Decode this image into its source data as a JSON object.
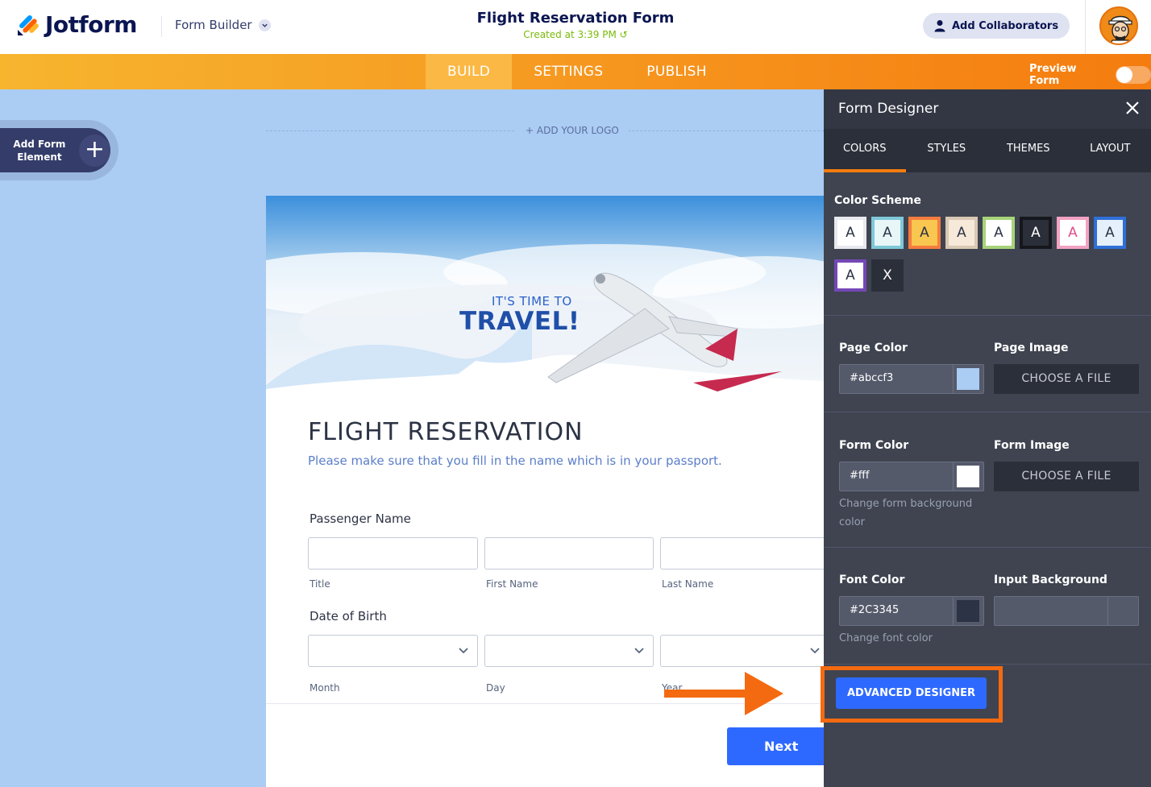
{
  "header": {
    "logo_text": "Jotform",
    "builder_label": "Form Builder",
    "form_title": "Flight Reservation Form",
    "created_text": "Created at 3:39 PM",
    "collab_label": "Add Collaborators"
  },
  "nav": {
    "tabs": [
      {
        "label": "BUILD",
        "active": true
      },
      {
        "label": "SETTINGS",
        "active": false
      },
      {
        "label": "PUBLISH",
        "active": false
      }
    ],
    "preview_label": "Preview Form",
    "preview_on": false
  },
  "canvas": {
    "add_element_label": "Add Form Element",
    "add_logo_label": "+ ADD YOUR LOGO",
    "background_color": "#abccf3"
  },
  "form": {
    "hero_small": "IT'S TIME TO",
    "hero_big": "TRAVEL!",
    "heading": "FLIGHT RESERVATION",
    "subheading": "Please make sure that you fill in the name which is in your passport.",
    "passenger_label": "Passenger Name",
    "name_fields": [
      "Title",
      "First Name",
      "Last Name"
    ],
    "dob_label": "Date of Birth",
    "dob_fields": [
      "Month",
      "Day",
      "Year"
    ],
    "next_label": "Next"
  },
  "designer": {
    "title": "Form Designer",
    "tabs": [
      {
        "label": "COLORS",
        "active": true
      },
      {
        "label": "STYLES",
        "active": false
      },
      {
        "label": "THEMES",
        "active": false
      },
      {
        "label": "LAYOUT",
        "active": false
      }
    ],
    "color_scheme_label": "Color Scheme",
    "schemes": [
      {
        "letter": "A",
        "bg": "#ffffff",
        "border": "#e8e9ee",
        "fg": "#2c3345"
      },
      {
        "letter": "A",
        "bg": "#e8f6f8",
        "border": "#7ec8d8",
        "fg": "#2c3345"
      },
      {
        "letter": "A",
        "bg": "#f9c74f",
        "border": "#f57c3f",
        "fg": "#2c3345"
      },
      {
        "letter": "A",
        "bg": "#f6e9da",
        "border": "#d9c8b3",
        "fg": "#2c3345"
      },
      {
        "letter": "A",
        "bg": "#ffffff",
        "border": "#a7d37a",
        "fg": "#2c3345"
      },
      {
        "letter": "A",
        "bg": "#2b2f3a",
        "border": "#15171d",
        "fg": "#ffffff"
      },
      {
        "letter": "A",
        "bg": "#ffffff",
        "border": "#f2a2c3",
        "fg": "#e04f8a"
      },
      {
        "letter": "A",
        "bg": "#e6f0fb",
        "border": "#2f6fd8",
        "fg": "#2c3345"
      },
      {
        "letter": "A",
        "bg": "#ffffff",
        "border": "#7447b6",
        "fg": "#2c3345"
      },
      {
        "letter": "X",
        "bg": "#2b2f3a",
        "border": "#2b2f3a",
        "fg": "#ffffff"
      }
    ],
    "page_color_label": "Page Color",
    "page_color_value": "#abccf3",
    "page_image_label": "Page Image",
    "form_color_label": "Form Color",
    "form_color_value": "#fff",
    "form_color_help": "Change form background color",
    "form_image_label": "Form Image",
    "choose_file_label": "CHOOSE A FILE",
    "font_color_label": "Font Color",
    "font_color_value": "#2C3345",
    "font_color_help": "Change font color",
    "input_bg_label": "Input Background",
    "input_bg_value": "",
    "advanced_label": "ADVANCED DESIGNER"
  },
  "colors": {
    "accent_orange": "#f57c0f",
    "primary_blue": "#2e69ff",
    "panel_bg": "#3f4450"
  }
}
